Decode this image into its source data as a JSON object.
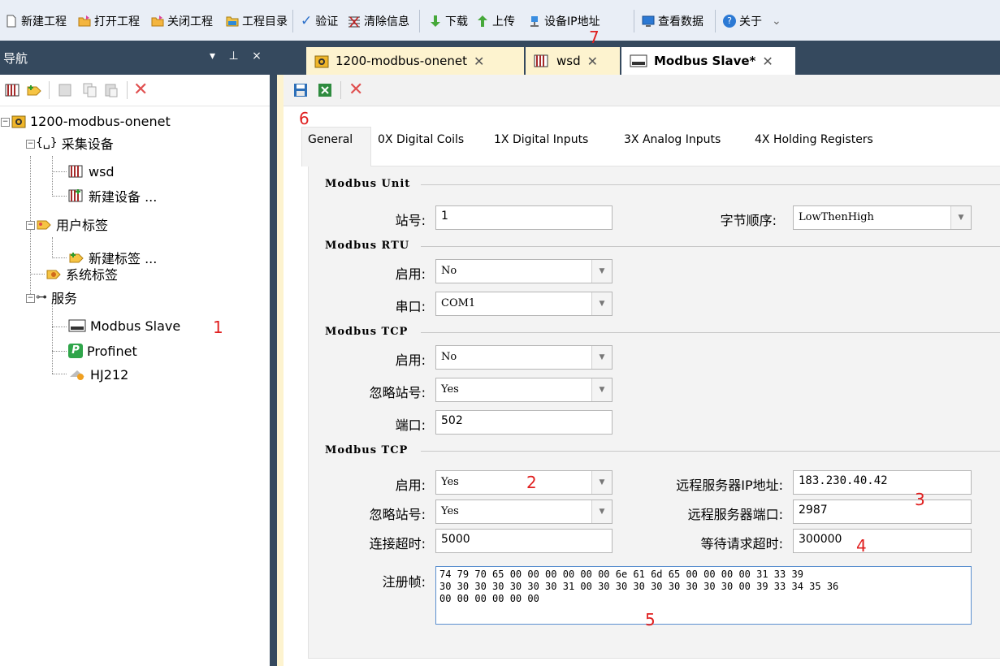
{
  "toolbar": {
    "new_project": "新建工程",
    "open_project": "打开工程",
    "close_project": "关闭工程",
    "project_dir": "工程目录",
    "verify": "验证",
    "clear_info": "清除信息",
    "download": "下载",
    "upload": "上传",
    "device_ip": "设备IP地址",
    "view_data": "查看数据",
    "about": "关于"
  },
  "nav": {
    "title": "导航",
    "pin": "▾ ⊥ ×",
    "tree": {
      "root": "1200-modbus-onenet",
      "collect": "采集设备",
      "wsd": "wsd",
      "new_device": "新建设备 ...",
      "user_tags": "用户标签",
      "new_tag": "新建标签 ...",
      "system_tags": "系统标签",
      "services": "服务",
      "modbus_slave": "Modbus Slave",
      "profinet": "Profinet",
      "hj212": "HJ212"
    }
  },
  "doc_tabs": [
    {
      "label": "1200-modbus-onenet"
    },
    {
      "label": "wsd"
    },
    {
      "label": "Modbus Slave*"
    }
  ],
  "page_tabs": [
    "General",
    "0X Digital Coils",
    "1X Digital Inputs",
    "3X Analog Inputs",
    "4X Holding Registers"
  ],
  "form": {
    "unit_title": "Modbus Unit",
    "station_label": "站号:",
    "station_value": "1",
    "byte_order_label": "字节顺序:",
    "byte_order_value": "LowThenHigh",
    "rtu_title": "Modbus RTU",
    "rtu_enable_label": "启用:",
    "rtu_enable_value": "No",
    "rtu_port_label": "串口:",
    "rtu_port_value": "COM1",
    "tcp_title": "Modbus TCP",
    "tcp_enable_label": "启用:",
    "tcp_enable_value": "No",
    "tcp_ignore_label": "忽略站号:",
    "tcp_ignore_value": "Yes",
    "tcp_port_label": "端口:",
    "tcp_port_value": "502",
    "tcp2_title": "Modbus TCP",
    "tcp2_enable_label": "启用:",
    "tcp2_enable_value": "Yes",
    "tcp2_ignore_label": "忽略站号:",
    "tcp2_ignore_value": "Yes",
    "timeout_label": "连接超时:",
    "timeout_value": "5000",
    "remote_ip_label": "远程服务器IP地址:",
    "remote_ip_value": "183.230.40.42",
    "remote_port_label": "远程服务器端口:",
    "remote_port_value": "2987",
    "wait_label": "等待请求超时:",
    "wait_value": "300000",
    "reg_label": "注册帧:",
    "reg_line1": "74 79 70 65 00 00 00 00 00 00 6e 61 6d 65 00 00 00 00 31 33 39",
    "reg_line2": "30 30 30 30 30 30 30 31 00 30 30 30 30 30 30 30 30 00 39 33 34 35 36",
    "reg_line3": "00 00 00 00 00 00"
  },
  "annotations": {
    "a1": "1",
    "a2": "2",
    "a3": "3",
    "a4": "4",
    "a5": "5",
    "a6": "6",
    "a7": "7"
  }
}
